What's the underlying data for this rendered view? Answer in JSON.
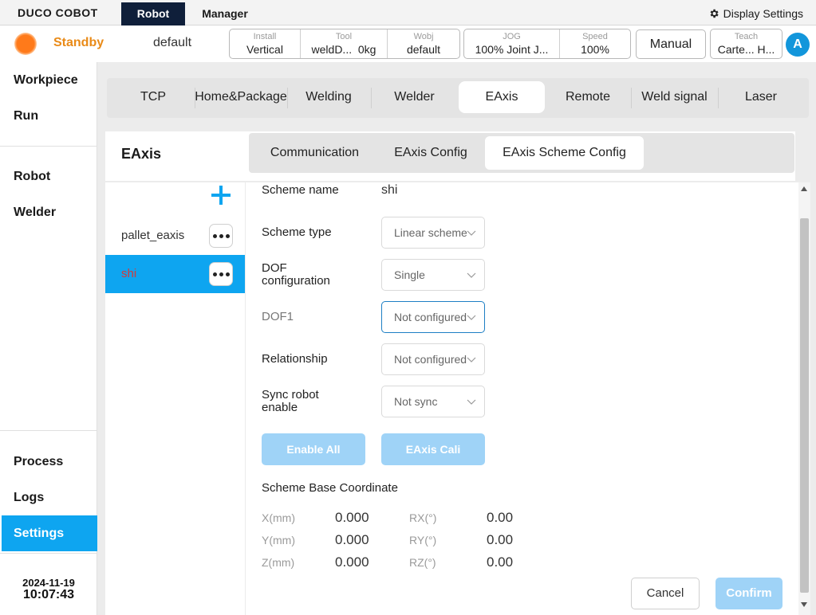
{
  "topbar": {
    "logo": "DUCO COBOT",
    "tabs": [
      "Robot",
      "Manager"
    ],
    "display_settings": "Display Settings",
    "gear_icon": "gear-icon"
  },
  "status": {
    "state": "Standby",
    "state_color": "#e98a17",
    "program": "default",
    "install": {
      "label": "Install",
      "value": "Vertical"
    },
    "tool": {
      "label": "Tool",
      "name": "weldD...",
      "weight": "0kg"
    },
    "wobj": {
      "label": "Wobj",
      "value": "default"
    },
    "jog": {
      "label": "JOG",
      "value": "100% Joint J..."
    },
    "speed": {
      "label": "Speed",
      "value": "100%"
    },
    "mode": "Manual",
    "teach": {
      "label": "Teach",
      "value": "Carte... H..."
    },
    "avatar": "A"
  },
  "sidebar": {
    "items": [
      "Workpiece",
      "Run",
      "Robot",
      "Welder",
      "Process",
      "Logs",
      "Settings"
    ],
    "active": "Settings",
    "date": "2024-11-19",
    "time": "10:07:43"
  },
  "category_tabs": [
    "TCP",
    "Home&Package",
    "Welding",
    "Welder",
    "EAxis",
    "Remote",
    "Weld signal",
    "Laser"
  ],
  "category_active": "EAxis",
  "panel": {
    "title": "EAxis",
    "sub_tabs": [
      "Communication",
      "EAxis Config",
      "EAxis Scheme Config"
    ],
    "sub_active": "EAxis Scheme Config"
  },
  "schemes": {
    "add_icon": "plus-icon",
    "items": [
      "pallet_eaxis",
      "shi"
    ],
    "selected": "shi"
  },
  "form": {
    "scheme_name_label": "Scheme name",
    "scheme_name": "shi",
    "scheme_type_label": "Scheme type",
    "scheme_type": "Linear scheme",
    "dof_config_label": "DOF\nconfiguration",
    "dof_config": "Single",
    "dof1_label": "DOF1",
    "dof1": "Not configured",
    "relationship_label": "Relationship",
    "relationship": "Not configured",
    "sync_label": "Sync robot\nenable",
    "sync": "Not sync",
    "enable_all": "Enable All",
    "eaxis_cali": "EAxis Cali",
    "base_coord_title": "Scheme Base Coordinate",
    "coords": {
      "x_label": "X(mm)",
      "x": "0.000",
      "y_label": "Y(mm)",
      "y": "0.000",
      "z_label": "Z(mm)",
      "z": "0.000",
      "rx_label": "RX(°)",
      "rx": "0.00",
      "ry_label": "RY(°)",
      "ry": "0.00",
      "rz_label": "RZ(°)",
      "rz": "0.00"
    },
    "cancel": "Cancel",
    "confirm": "Confirm"
  },
  "colors": {
    "accent": "#0ea5f0",
    "nav_dark": "#0f1f3a",
    "disabled_button": "#9fd3f7"
  }
}
